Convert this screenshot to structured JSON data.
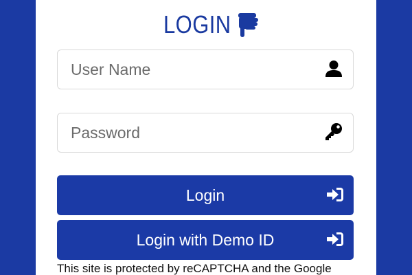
{
  "form": {
    "title": "LOGIN",
    "username": {
      "placeholder": "User Name",
      "value": ""
    },
    "password": {
      "placeholder": "Password",
      "value": ""
    },
    "login_button_label": "Login",
    "demo_button_label": "Login with Demo ID",
    "recaptcha_notice": "This site is protected by reCAPTCHA and the Google"
  },
  "icons": {
    "title_icon": "hand-pointing-down-icon",
    "username_icon": "user-icon",
    "password_icon": "key-icon",
    "button_icon": "sign-in-icon"
  },
  "colors": {
    "brand": "#1b3aa6",
    "title": "#1a3aa0",
    "card": "#ffffff"
  }
}
